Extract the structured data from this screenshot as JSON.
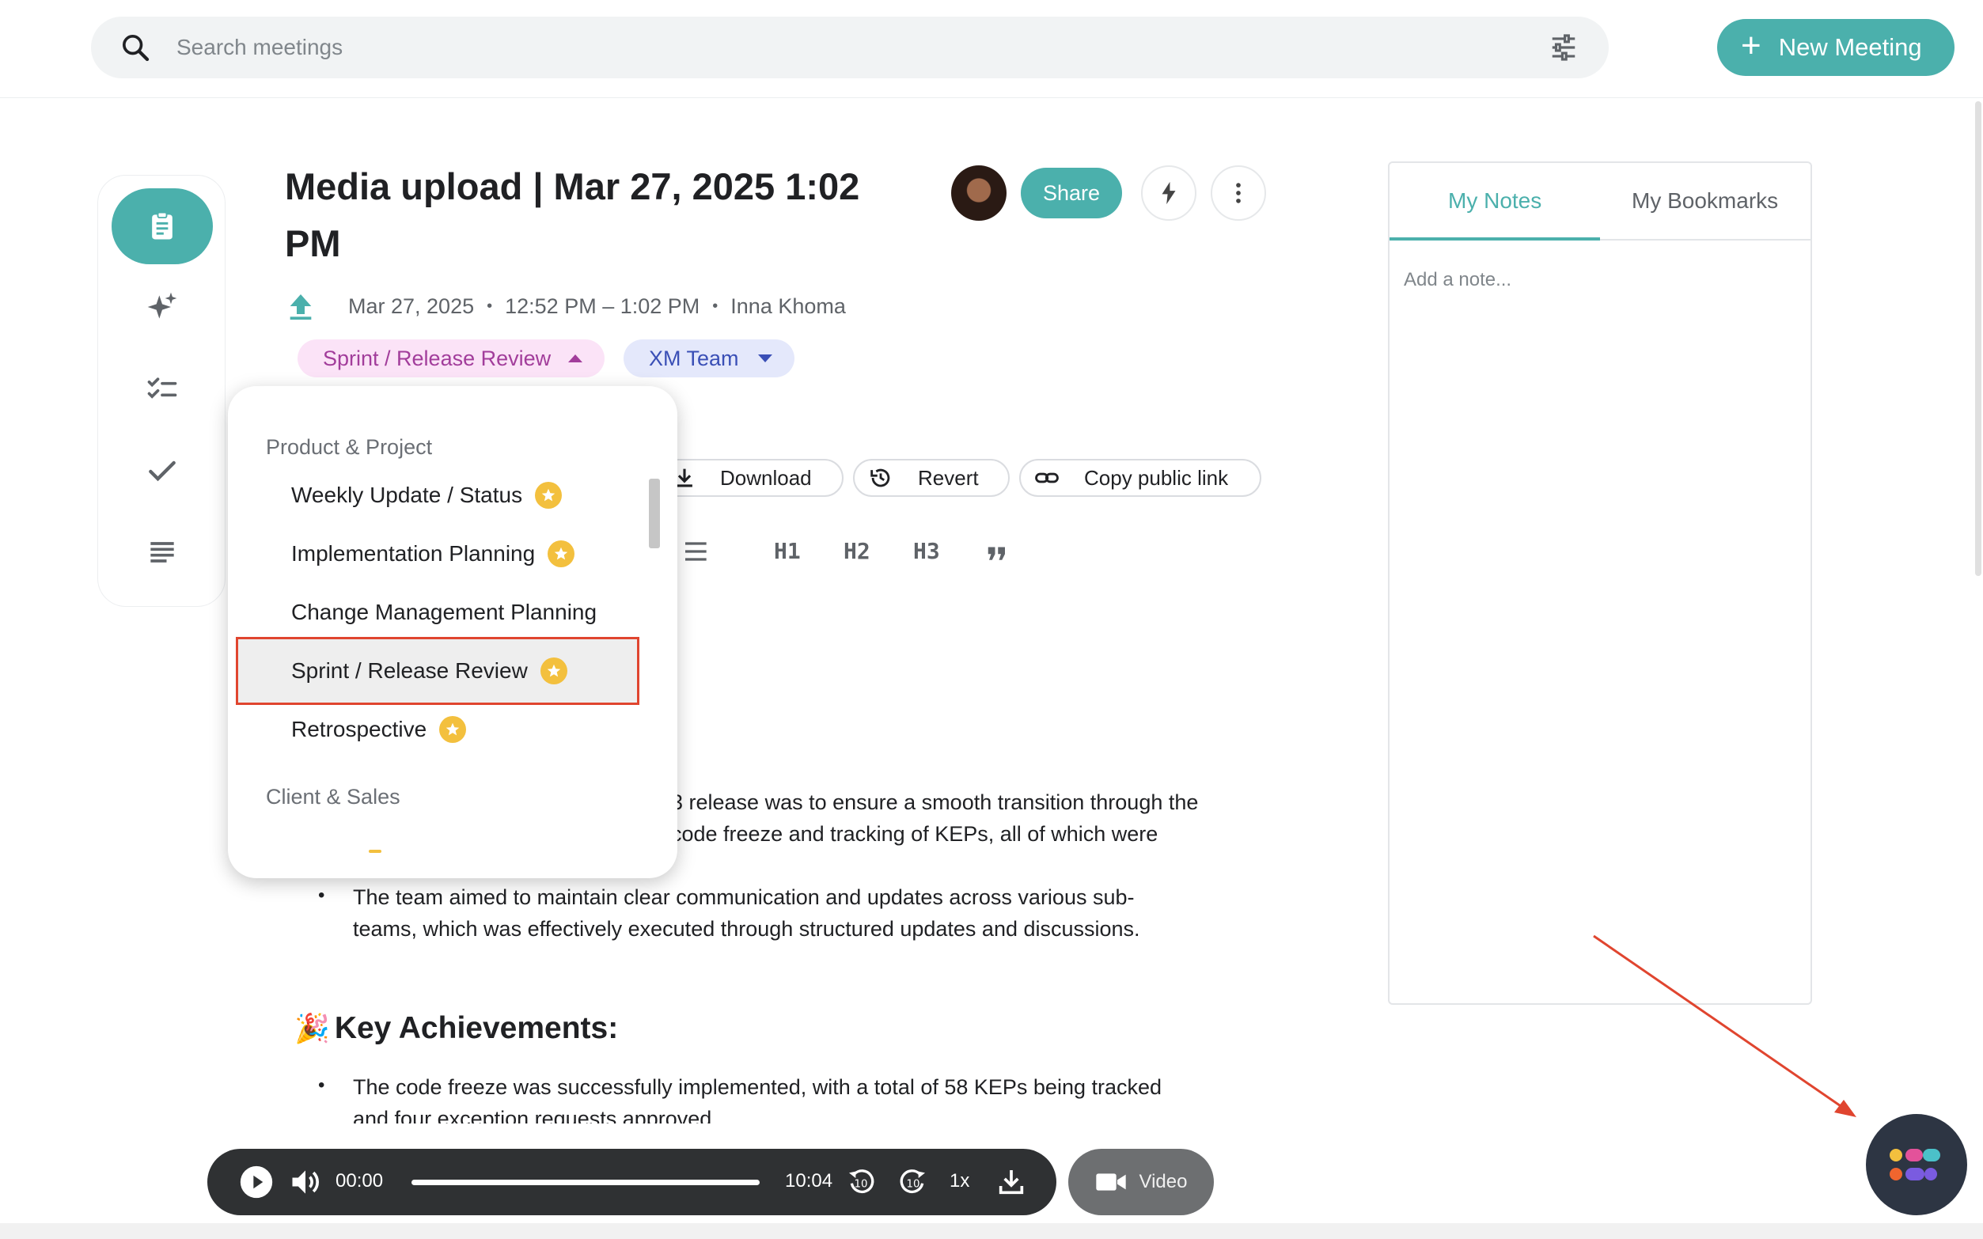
{
  "search": {
    "placeholder": "Search meetings"
  },
  "header": {
    "new_meeting_label": "New Meeting"
  },
  "meeting": {
    "title": "Media upload | Mar 27, 2025 1:02 PM",
    "date": "Mar 27, 2025",
    "time_range": "12:52 PM – 1:02 PM",
    "owner": "Inna Khoma",
    "share_label": "Share"
  },
  "tags": [
    {
      "label": "Sprint / Release Review",
      "color": "#a23d9b"
    },
    {
      "label": "XM Team",
      "color": "#3a4fb6"
    }
  ],
  "toolbar": {
    "download_label": "Download",
    "revert_label": "Revert",
    "copy_link_label": "Copy public link",
    "h1": "H1",
    "h2": "H2",
    "h3": "H3"
  },
  "dropdown": {
    "groups": [
      {
        "label": "Product & Project",
        "options": [
          {
            "label": "Weekly Update / Status",
            "starred": true
          },
          {
            "label": "Implementation Planning",
            "starred": true
          },
          {
            "label": "Change Management Planning",
            "starred": false
          },
          {
            "label": "Sprint / Release Review",
            "starred": true,
            "selected": true
          },
          {
            "label": "Retrospective",
            "starred": true
          }
        ]
      },
      {
        "label": "Client & Sales",
        "options": []
      }
    ]
  },
  "content": {
    "para1_line1": "3 release was to ensure a smooth transition through the",
    "para1_line2": "code freeze and tracking of KEPs, all of which were",
    "para2_line1": "The team aimed to maintain clear communication and updates across various sub-",
    "para2_line2": "teams, which was effectively executed through structured updates and discussions.",
    "achievements_heading": "Key Achievements:",
    "ach1_line1": "The code freeze was successfully implemented, with a total of 58 KEPs being tracked",
    "ach1_line2": "and four exception requests approved."
  },
  "notes": {
    "tab_notes": "My Notes",
    "tab_bookmarks": "My Bookmarks",
    "placeholder": "Add a note..."
  },
  "player": {
    "current_time": "00:00",
    "duration": "10:04",
    "speed": "1x",
    "progress": 0,
    "video_label": "Video"
  },
  "colors": {
    "accent": "#4bb0ac",
    "highlight": "#e0452f",
    "star": "#f3c03e"
  }
}
